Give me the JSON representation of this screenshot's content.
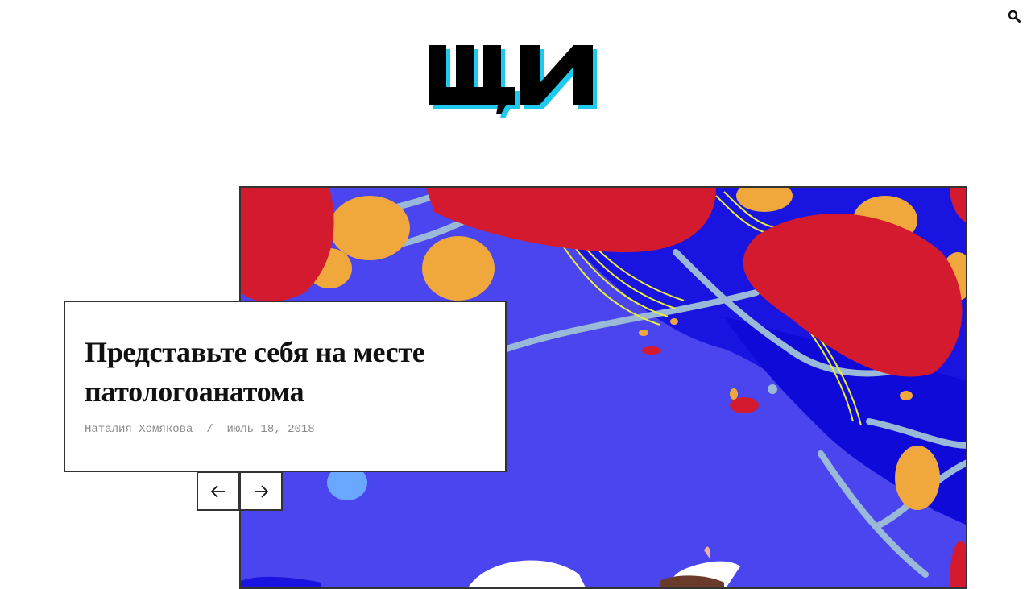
{
  "header": {
    "logo_text": "ЩИ",
    "search_icon": "search-icon"
  },
  "colors": {
    "accent_cyan": "#1ec8ee",
    "logo_black": "#000000",
    "hero_blue": "#4a45ee",
    "hero_red": "#d41a2e",
    "hero_orange": "#f0a83c",
    "hero_yellow": "#e8ee3a",
    "meta_gray": "#8a8a8a"
  },
  "featured": {
    "title": "Представьте себя на месте патологоанатома",
    "author": "Наталия Хомякова",
    "separator": "/",
    "date": "июль 18, 2018"
  },
  "slider": {
    "prev_icon": "arrow-left-icon",
    "next_icon": "arrow-right-icon"
  }
}
